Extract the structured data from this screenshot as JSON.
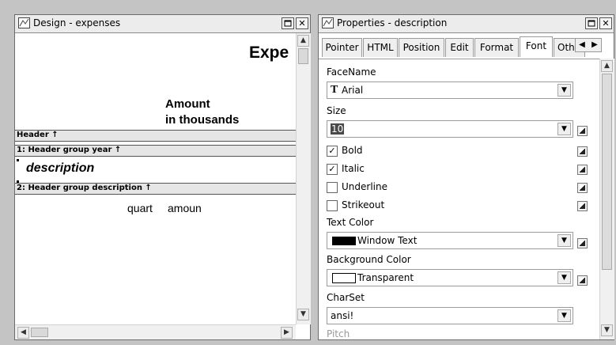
{
  "design": {
    "title": "Design - expenses",
    "report_title": "Expe",
    "column_header_line1": "Amount",
    "column_header_line2": "in thousands",
    "bands": [
      "Header ↑",
      "1: Header group year ↑",
      "2: Header group description ↑"
    ],
    "field_description": "description",
    "field_quart": "quart",
    "field_amount": "amoun"
  },
  "properties": {
    "title": "Properties -  description",
    "tabs": [
      "Pointer",
      "HTML",
      "Position",
      "Edit",
      "Format",
      "Font",
      "Oth"
    ],
    "active_tab": "Font",
    "facename_label": "FaceName",
    "facename_value": "Arial",
    "size_label": "Size",
    "size_value": "10",
    "bold_label": "Bold",
    "bold_checked": true,
    "italic_label": "Italic",
    "italic_checked": true,
    "underline_label": "Underline",
    "underline_checked": false,
    "strikeout_label": "Strikeout",
    "strikeout_checked": false,
    "textcolor_label": "Text Color",
    "textcolor_value": "Window Text",
    "textcolor_swatch": "#000000",
    "bgcolor_label": "Background Color",
    "bgcolor_value": "Transparent",
    "charset_label": "CharSet",
    "charset_value": "ansi!",
    "pitch_label": "Pitch"
  },
  "icons": [
    "window-icon",
    "restore-icon",
    "close-icon",
    "scroll-up-icon",
    "scroll-down-icon",
    "scroll-left-icon",
    "scroll-right-icon",
    "dropdown-arrow-icon",
    "truetype-font-icon",
    "default-value-icon"
  ]
}
